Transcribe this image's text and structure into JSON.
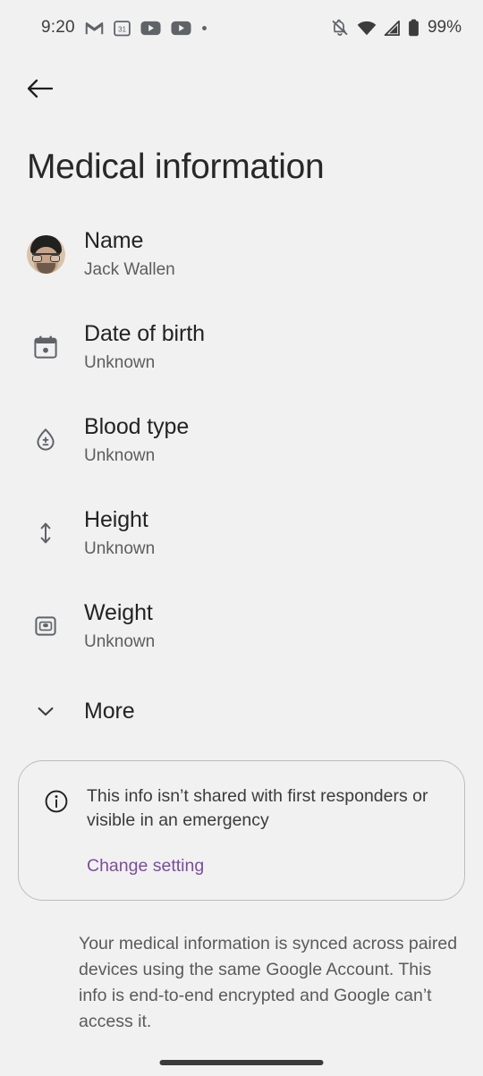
{
  "status_bar": {
    "time": "9:20",
    "left_icons": [
      "gmail-icon",
      "calendar-icon",
      "youtube-icon",
      "youtube-icon",
      "overflow-dot-icon"
    ],
    "right_icons": [
      "ringer-muted-icon",
      "wifi-icon",
      "cellular-signal-icon",
      "battery-icon"
    ],
    "battery_percent": "99%"
  },
  "nav": {
    "back_icon": "arrow-back-icon"
  },
  "header": {
    "title": "Medical information"
  },
  "list": {
    "items": [
      {
        "icon": "avatar",
        "label": "Name",
        "value": "Jack Wallen"
      },
      {
        "icon": "calendar-icon",
        "label": "Date of birth",
        "value": "Unknown"
      },
      {
        "icon": "blood-drop-icon",
        "label": "Blood type",
        "value": "Unknown"
      },
      {
        "icon": "height-arrows-icon",
        "label": "Height",
        "value": "Unknown"
      },
      {
        "icon": "weight-scale-icon",
        "label": "Weight",
        "value": "Unknown"
      }
    ],
    "more": {
      "label": "More",
      "icon": "chevron-down-icon"
    }
  },
  "info_card": {
    "icon": "info-icon",
    "text": "This info isn’t shared with first responders or visible in an emergency",
    "link_label": "Change setting"
  },
  "footer": {
    "note": "Your medical information is synced across paired devices using the same Google Account. This info is end-to-end encrypted and Google can’t access it."
  },
  "colors": {
    "background": "#f1f1f1",
    "link_purple": "#7c4d9b",
    "primary_text": "#232323",
    "secondary_text": "#5d5d5d"
  }
}
